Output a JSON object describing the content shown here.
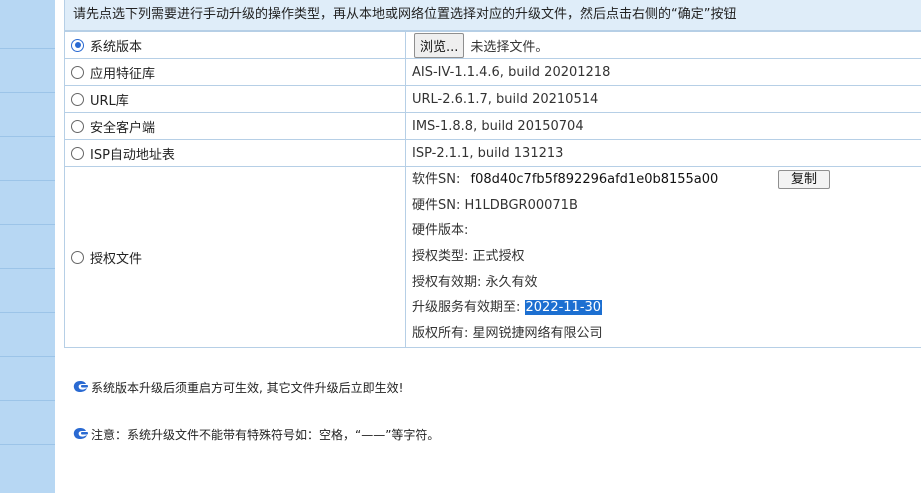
{
  "instruction": "请先点选下列需要进行手动升级的操作类型，再从本地或网络位置选择对应的升级文件，然后点击右侧的“确定”按钮",
  "rows": [
    {
      "label": "系统版本",
      "checked": true
    },
    {
      "label": "应用特征库",
      "value": "AIS-IV-1.1.4.6, build 20201218"
    },
    {
      "label": "URL库",
      "value": "URL-2.6.1.7, build 20210514"
    },
    {
      "label": "安全客户端",
      "value": "IMS-1.8.8, build 20150704"
    },
    {
      "label": "ISP自动地址表",
      "value": "ISP-2.1.1, build 131213"
    },
    {
      "label": "授权文件"
    }
  ],
  "file_input": {
    "browse_label": "浏览...",
    "no_file_text": "未选择文件。"
  },
  "license": {
    "software_sn_label": "软件SN:",
    "software_sn_value": "f08d40c7fb5f892296afd1e0b8155a00",
    "copy_label": "复制",
    "hardware_sn": "硬件SN: H1LDBGR00071B",
    "hardware_version": "硬件版本:",
    "license_type": "授权类型: 正式授权",
    "license_validity": "授权有效期: 永久有效",
    "upgrade_service_label": "升级服务有效期至: ",
    "upgrade_service_date": "2022-11-30",
    "copyright": "版权所有: 星网锐捷网络有限公司"
  },
  "notes": [
    "系统版本升级后须重启方可生效, 其它文件升级后立即生效!",
    "注意：系统升级文件不能带有特殊符号如：空格，“——”等字符。"
  ],
  "colors": {
    "sidebar": "#b7d7f3",
    "header_bg": "#dfedf9",
    "border": "#b6cfe6",
    "accent": "#2a6ad2",
    "selection": "#1c6fd1"
  }
}
